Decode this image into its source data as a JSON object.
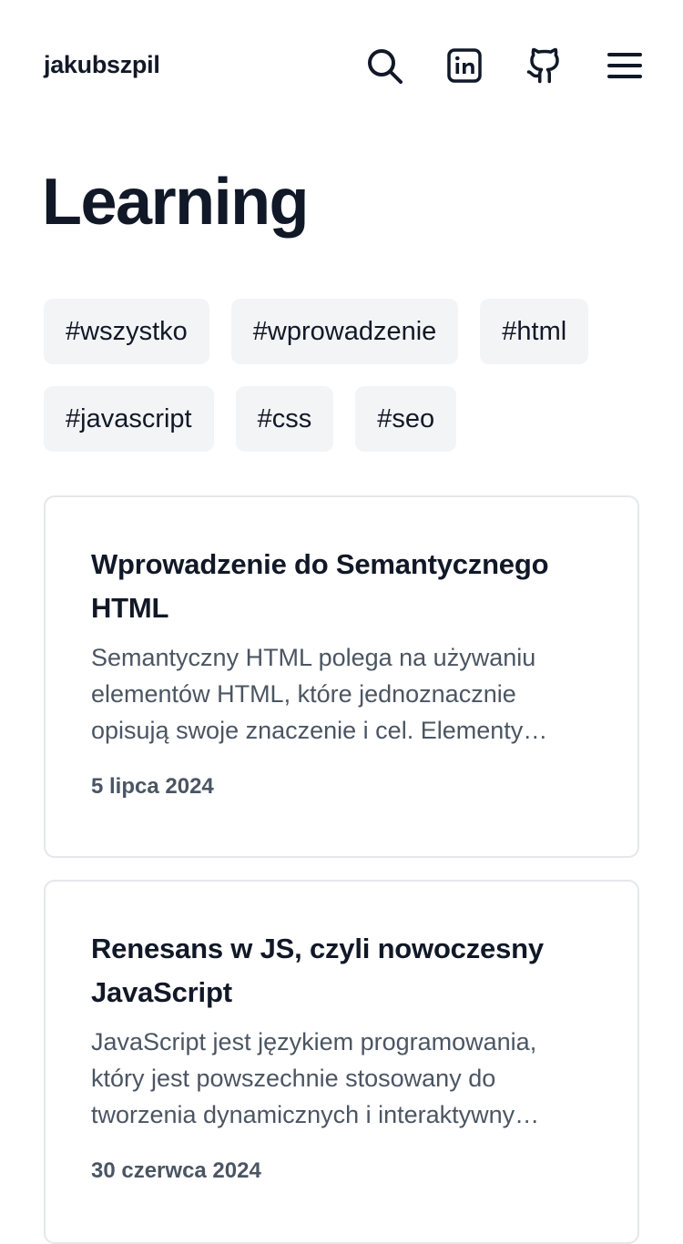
{
  "header": {
    "brand": "jakubszpil",
    "icons": [
      "search-icon",
      "linkedin-icon",
      "github-icon",
      "menu-icon"
    ]
  },
  "page": {
    "title": "Learning"
  },
  "tags": [
    "#wszystko",
    "#wprowadzenie",
    "#html",
    "#javascript",
    "#css",
    "#seo"
  ],
  "posts": [
    {
      "title": "Wprowadzenie do Semantycznego HTML",
      "excerpt": "Semantyczny HTML polega na używaniu elementów HTML, które jednoznacznie opisują swoje znaczenie i cel. Elementy…",
      "date": "5 lipca 2024"
    },
    {
      "title": "Renesans w JS, czyli nowoczesny JavaScript",
      "excerpt": "JavaScript jest językiem programowania, który jest powszechnie stosowany do tworzenia dynamicznych i interaktywny…",
      "date": "30 czerwca 2024"
    }
  ],
  "colors": {
    "text": "#111827",
    "muted": "#4b5563",
    "tag_bg": "#f3f4f6",
    "card_border": "#e5e7eb"
  }
}
